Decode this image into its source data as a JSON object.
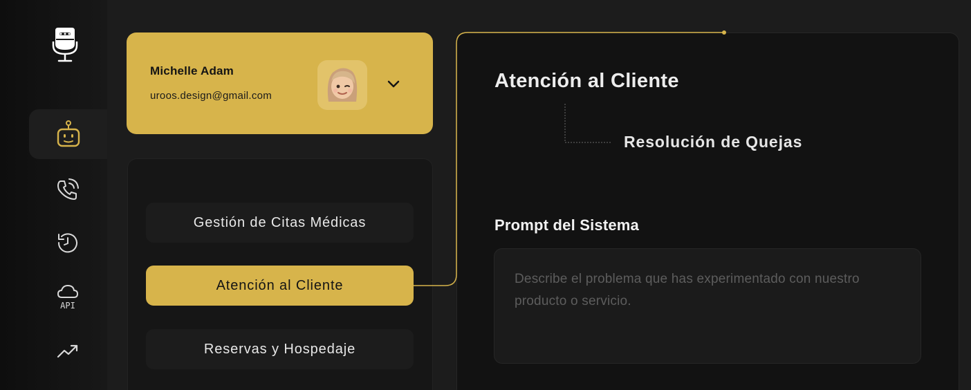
{
  "sidebar": {
    "logo_icon": "microphone-icon",
    "items": [
      {
        "icon": "bot-icon",
        "active": true
      },
      {
        "icon": "phone-call-icon",
        "active": false
      },
      {
        "icon": "history-icon",
        "active": false
      },
      {
        "icon": "cloud-api-icon",
        "label": "API",
        "active": false
      },
      {
        "icon": "trending-up-icon",
        "active": false
      }
    ]
  },
  "profile": {
    "name": "Michelle Adam",
    "email": "uroos.design@gmail.com",
    "avatar_icon": "avatar",
    "dropdown_icon": "chevron-down-icon"
  },
  "categories": [
    {
      "label": "Gestión de Citas Médicas",
      "active": false
    },
    {
      "label": "Atención al Cliente",
      "active": true
    },
    {
      "label": "Reservas y Hospedaje",
      "active": false
    }
  ],
  "detail": {
    "title": "Atención al Cliente",
    "subtitle": "Resolución de Quejas",
    "prompt_label": "Prompt del Sistema",
    "prompt_placeholder": "Describe el problema que has experimentado con nuestro producto o servicio.",
    "prompt_value": ""
  },
  "colors": {
    "accent": "#d7b44b",
    "background": "#1c1c1c",
    "panel": "#121212"
  }
}
